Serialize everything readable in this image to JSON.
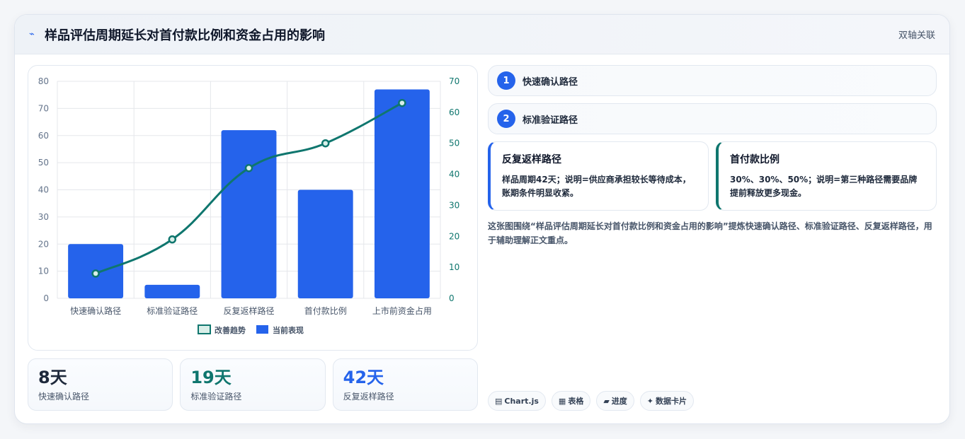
{
  "header": {
    "title": "样品评估周期延长对首付款比例和资金占用的影响",
    "tag": "双轴关联",
    "icon": "line-chart-icon"
  },
  "chart_data": {
    "type": "bar",
    "categories": [
      "快速确认路径",
      "标准验证路径",
      "反复返样路径",
      "首付款比例",
      "上市前资金占用"
    ],
    "series": [
      {
        "name": "当前表现",
        "type": "bar",
        "axis": "left",
        "color": "#2563eb",
        "values": [
          20,
          5,
          62,
          40,
          77
        ]
      },
      {
        "name": "改善趋势",
        "type": "line",
        "axis": "right",
        "color": "#0f766e",
        "values": [
          8,
          19,
          42,
          50,
          63
        ]
      }
    ],
    "y_left": {
      "ylim": [
        0,
        80
      ],
      "ticks": [
        0,
        10,
        20,
        30,
        40,
        50,
        60,
        70,
        80
      ]
    },
    "y_right": {
      "ylim": [
        0,
        70
      ],
      "ticks": [
        0,
        10,
        20,
        30,
        40,
        50,
        60,
        70
      ]
    },
    "legend": [
      "改善趋势",
      "当前表现"
    ],
    "legend_position": "bottom",
    "grid": true
  },
  "stats": [
    {
      "value": "8天",
      "label": "快速确认路径",
      "color": "#1e293b"
    },
    {
      "value": "19天",
      "label": "标准验证路径",
      "color": "#0f766e"
    },
    {
      "value": "42天",
      "label": "反复返样路径",
      "color": "#2563eb"
    }
  ],
  "steps": [
    {
      "num": "1",
      "label": "快速确认路径"
    },
    {
      "num": "2",
      "label": "标准验证路径"
    }
  ],
  "details": [
    {
      "title": "反复返样路径",
      "text": "样品周期42天；说明=供应商承担较长等待成本，账期条件明显收紧。"
    },
    {
      "title": "首付款比例",
      "text": "30%、30%、50%；说明=第三种路径需要品牌提前释放更多现金。"
    }
  ],
  "summary": "这张图围绕“样品评估周期延长对首付款比例和资金占用的影响”提炼快速确认路径、标准验证路径、反复返样路径，用于辅助理解正文重点。",
  "pills": [
    {
      "icon": "▤",
      "label": "Chart.js"
    },
    {
      "icon": "▦",
      "label": "表格"
    },
    {
      "icon": "▰",
      "label": "进度"
    },
    {
      "icon": "✦",
      "label": "数据卡片"
    }
  ]
}
